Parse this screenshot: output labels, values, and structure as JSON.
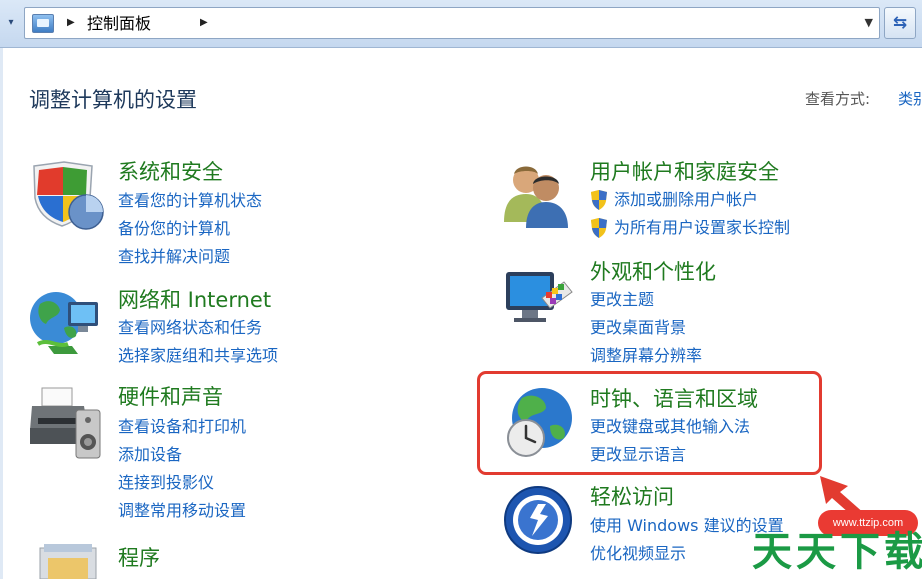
{
  "address_bar": {
    "breadcrumb": "控制面板",
    "dropdown_icon": "chevron-down-icon",
    "refresh_icon": "refresh-icon"
  },
  "page": {
    "title": "调整计算机的设置",
    "view_by_label": "查看方式:",
    "view_by_value": "类别"
  },
  "categories": [
    {
      "title": "系统和安全",
      "icon": "shield-chart-icon",
      "links": [
        "查看您的计算机状态",
        "备份您的计算机",
        "查找并解决问题"
      ]
    },
    {
      "title": "网络和 Internet",
      "icon": "network-globe-icon",
      "links": [
        "查看网络状态和任务",
        "选择家庭组和共享选项"
      ]
    },
    {
      "title": "硬件和声音",
      "icon": "printer-icon",
      "links": [
        "查看设备和打印机",
        "添加设备",
        "连接到投影仪",
        "调整常用移动设置"
      ]
    },
    {
      "title": "程序",
      "icon": "programs-icon",
      "links": []
    },
    {
      "title": "用户帐户和家庭安全",
      "icon": "users-icon",
      "links": [
        "添加或删除用户帐户",
        "为所有用户设置家长控制"
      ]
    },
    {
      "title": "外观和个性化",
      "icon": "monitor-palette-icon",
      "links": [
        "更改主题",
        "更改桌面背景",
        "调整屏幕分辨率"
      ]
    },
    {
      "title": "时钟、语言和区域",
      "icon": "globe-clock-icon",
      "links": [
        "更改键盘或其他输入法",
        "更改显示语言"
      ]
    },
    {
      "title": "轻松访问",
      "icon": "ease-of-access-icon",
      "links": [
        "使用 Windows 建议的设置",
        "优化视频显示"
      ]
    }
  ],
  "annotation": {
    "highlight_color": "#e23b30"
  },
  "watermark": {
    "pill_text": "www.ttzip.com",
    "big_text": "天天下载"
  }
}
